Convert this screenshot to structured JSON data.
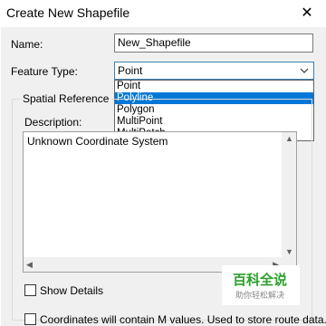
{
  "window": {
    "title": "Create New Shapefile",
    "close_glyph": "✕"
  },
  "form": {
    "name_label": "Name:",
    "name_value": "New_Shapefile",
    "feature_type_label": "Feature Type:",
    "feature_type_value": "Point",
    "feature_type_options": [
      "Point",
      "Polyline",
      "Polygon",
      "MultiPoint",
      "MultiPatch"
    ],
    "highlighted_option": "Polyline"
  },
  "spatial_reference": {
    "group_label": "Spatial Reference",
    "description_label": "Description:",
    "description_text": "Unknown Coordinate System"
  },
  "checkboxes": {
    "show_details_label": "Show Details",
    "show_details_checked": false,
    "m_values_label": "Coordinates will contain M values. Used to store route data.",
    "m_values_checked": false
  },
  "watermark": {
    "title": "百科全说",
    "subtitle": "助你轻松解决"
  },
  "colors": {
    "selection": "#0078d7",
    "combo_border": "#3c7fb1",
    "dialog_bg": "#f0f0f0",
    "watermark_green": "#2aa12a"
  }
}
